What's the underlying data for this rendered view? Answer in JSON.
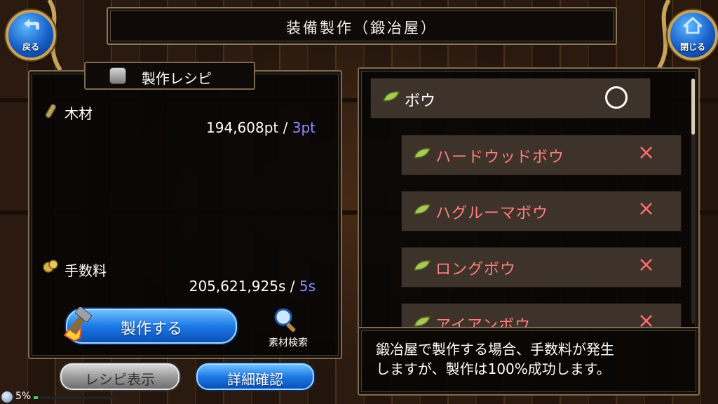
{
  "header": {
    "title": "装備製作（鍛冶屋）"
  },
  "nav": {
    "back_label": "戻る",
    "close_label": "閉じる"
  },
  "recipe": {
    "title": "製作レシピ",
    "materials": [
      {
        "name": "木材",
        "owned": "194,608pt",
        "separator": "/",
        "required": "3pt"
      }
    ],
    "fee": {
      "name": "手数料",
      "owned": "205,621,925s",
      "separator": "/",
      "required": "5s"
    }
  },
  "actions": {
    "make_label": "製作する",
    "search_label": "素材検索",
    "recipe_view_label": "レシピ表示",
    "detail_label": "詳細確認"
  },
  "list": {
    "category": {
      "name": "ボウ",
      "status": "○"
    },
    "items": [
      {
        "name": "ハードウッドボウ",
        "status": "×"
      },
      {
        "name": "ハグルーマボウ",
        "status": "×"
      },
      {
        "name": "ロングボウ",
        "status": "×"
      },
      {
        "name": "アイアンボウ",
        "status": "×"
      }
    ]
  },
  "message": {
    "line1": "鍛冶屋で製作する場合、手数料が発生",
    "line2": "しますが、製作は100%成功します。"
  },
  "status": {
    "load_percent": "5%",
    "load_fraction": 0.05
  },
  "colors": {
    "accent_blue": "#1d79e6",
    "ng_red": "#ff7d7d",
    "frame": "#7d6a50",
    "required_blue": "#8f8cff"
  },
  "icons": [
    "back-arrow-icon",
    "home-icon",
    "recipe-gear-icon",
    "wood-icon",
    "coin-icon",
    "hammer-icon",
    "magnifier-icon",
    "bow-leaf-icon"
  ]
}
